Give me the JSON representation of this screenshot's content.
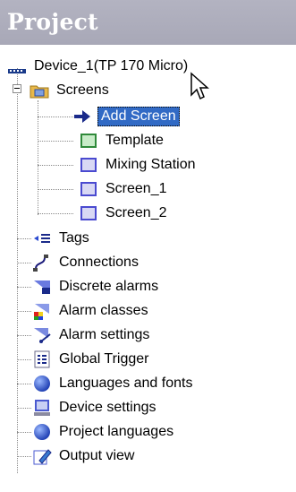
{
  "panel": {
    "title": "Project"
  },
  "tree": {
    "device": {
      "label": "Device_1(TP 170 Micro)",
      "icon": "device-icon"
    },
    "screens": {
      "label": "Screens",
      "icon": "folder-icon",
      "children": [
        {
          "label": "Add Screen",
          "icon": "add-arrow-icon",
          "selected": true
        },
        {
          "label": "Template",
          "icon": "template-screen-icon"
        },
        {
          "label": "Mixing Station",
          "icon": "screen-icon"
        },
        {
          "label": "Screen_1",
          "icon": "screen-icon"
        },
        {
          "label": "Screen_2",
          "icon": "screen-icon"
        }
      ]
    },
    "items": [
      {
        "label": "Tags",
        "icon": "tags-icon"
      },
      {
        "label": "Connections",
        "icon": "connections-icon"
      },
      {
        "label": "Discrete alarms",
        "icon": "discrete-alarms-icon"
      },
      {
        "label": "Alarm classes",
        "icon": "alarm-classes-icon"
      },
      {
        "label": "Alarm settings",
        "icon": "alarm-settings-icon"
      },
      {
        "label": "Global Trigger",
        "icon": "global-trigger-icon"
      },
      {
        "label": "Languages and fonts",
        "icon": "globe-icon"
      },
      {
        "label": "Device settings",
        "icon": "device-settings-icon"
      },
      {
        "label": "Project languages",
        "icon": "globe-icon"
      },
      {
        "label": "Output view",
        "icon": "output-view-icon"
      }
    ]
  },
  "colors": {
    "header": "#b3b3c1",
    "selection": "#316ac5"
  }
}
